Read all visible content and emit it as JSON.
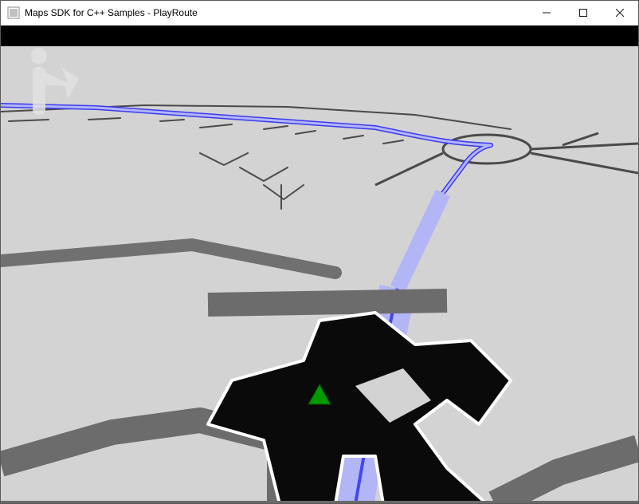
{
  "window": {
    "title": "Maps SDK for C++ Samples - PlayRoute",
    "icon": "application-icon"
  },
  "titlebar_controls": {
    "minimize": "Minimize",
    "maximize": "Maximize",
    "close": "Close"
  },
  "map": {
    "background_color": "#d3d3d3",
    "route_color": "#b2b6f6",
    "route_outline_color": "#3a3af0",
    "road_major_color": "#1f1f1f",
    "road_minor_color": "#6a6a6a",
    "heading_marker_color": "#00a000",
    "view_mode": "3d-perspective-follow"
  },
  "hud": {
    "status_band_color": "#000000",
    "turn_indicator": {
      "type": "merge-right",
      "color": "#e8e8e8"
    }
  }
}
